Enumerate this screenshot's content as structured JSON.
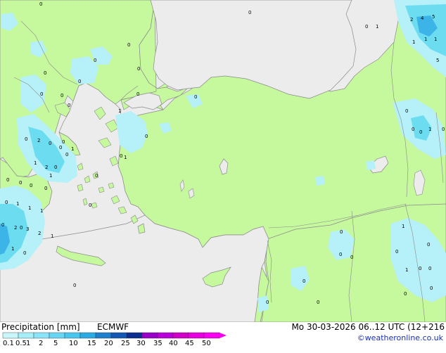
{
  "product": "Precipitation [mm]",
  "model": "ECMWF",
  "valid_time": "Mo 30-03-2026 06..12 UTC (12+216",
  "credit": "©weatheronline.co.uk",
  "colors": {
    "sea": "#ececec",
    "land": "#c6f89e",
    "coast": "#8a8a8a",
    "precip_light": "#b6f0f8",
    "precip_mid": "#6cdcf0",
    "precip_heavy": "#3cb4e8"
  },
  "legend": {
    "ticks": [
      "0.1",
      "0.5",
      "1",
      "2",
      "5",
      "10",
      "15",
      "20",
      "25",
      "30",
      "35",
      "40",
      "45",
      "50"
    ],
    "colors": [
      "#c8f6fa",
      "#a8eef8",
      "#88e4f6",
      "#68d6f2",
      "#48c6ee",
      "#2caae4",
      "#1e80cc",
      "#1458b4",
      "#0c2e90",
      "#9800c8",
      "#b800d8",
      "#d000c8",
      "#e800e0",
      "#f800f0"
    ]
  },
  "map_values": [
    "0",
    "0",
    "2",
    "4",
    "5",
    "1",
    "0",
    "1",
    "0",
    "1",
    "1",
    "5",
    "0",
    "0",
    "0",
    "0",
    "0",
    "0",
    "0",
    "1",
    "0",
    "0",
    "0",
    "1",
    "0",
    "2",
    "0",
    "0",
    "1",
    "0",
    "0",
    "1",
    "2",
    "0",
    "0",
    "0",
    "0",
    "0",
    "0",
    "0",
    "1",
    "1",
    "1",
    "0",
    "2",
    "3",
    "2",
    "1",
    "0",
    "1",
    "0",
    "0",
    "0",
    "1",
    "0",
    "1",
    "0",
    "0",
    "0",
    "0",
    "0",
    "0",
    "0",
    "1",
    "0",
    "0",
    "1",
    "0",
    "0",
    "0",
    "0",
    "0",
    "0",
    "0"
  ]
}
